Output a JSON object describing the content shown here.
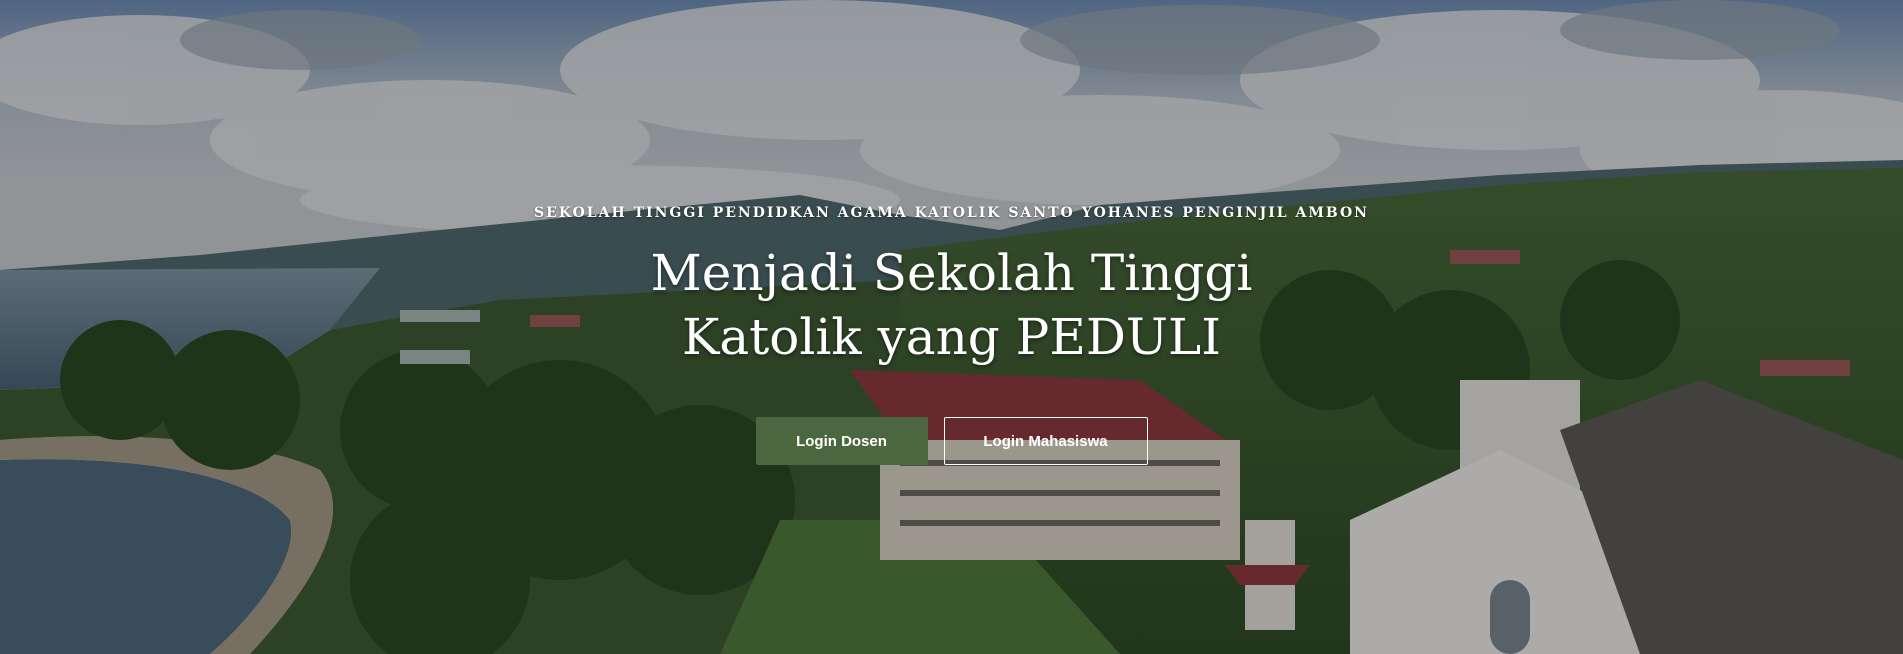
{
  "hero": {
    "eyebrow": "SEKOLAH TINGGI PENDIDKAN AGAMA KATOLIK SANTO YOHANES PENGINJIL AMBON",
    "headline": "Menjadi Sekolah Tinggi Katolik yang PEDULI",
    "background": "aerial photo of campus, church and coastline under cloudy sky"
  },
  "actions": {
    "login_dosen": "Login Dosen",
    "login_mahasiswa": "Login Mahasiswa"
  },
  "colors": {
    "primary_button": "#4c6640",
    "overlay": "rgba(0,0,0,0.28)",
    "text": "#ffffff"
  }
}
